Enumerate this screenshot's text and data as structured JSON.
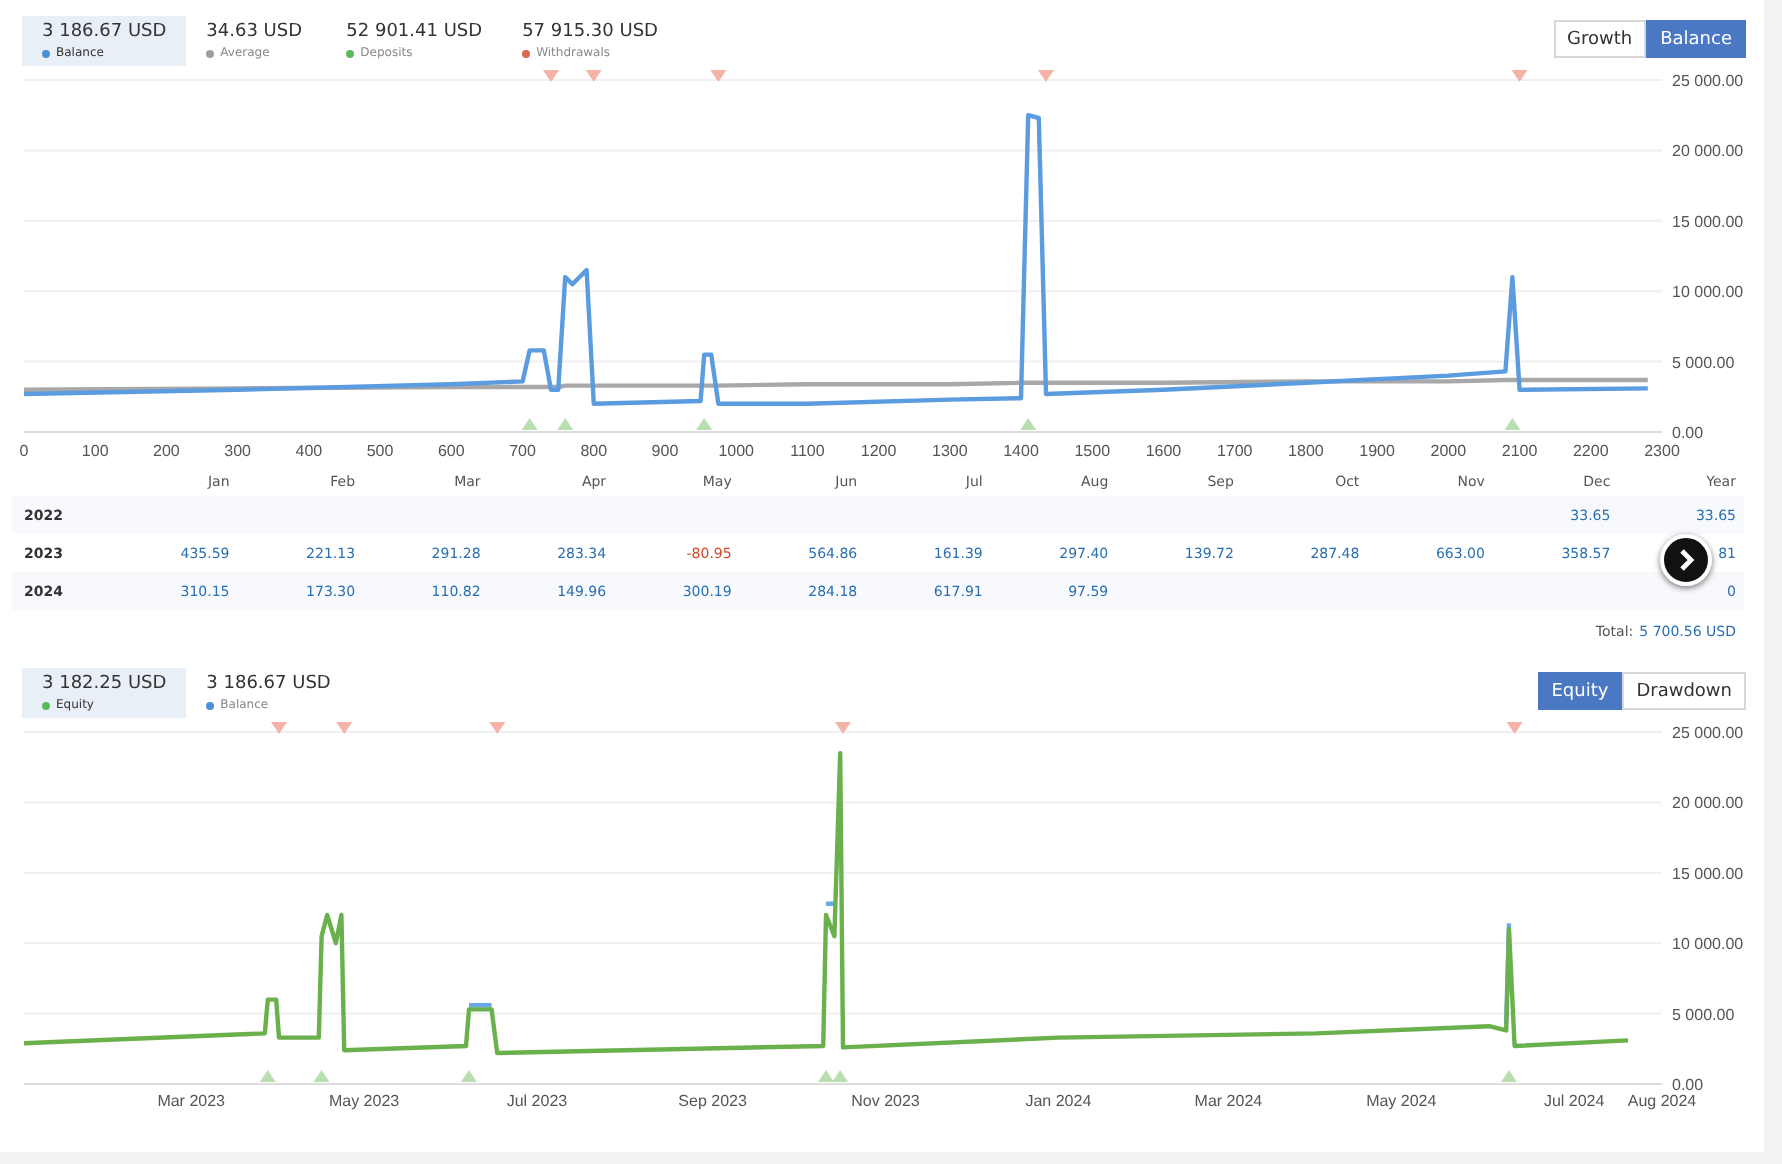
{
  "balance_section": {
    "stats": [
      {
        "value": "3 186.67 USD",
        "label": "Balance",
        "color": "#4a90d9",
        "selected": true
      },
      {
        "value": "34.63 USD",
        "label": "Average",
        "color": "#9e9e9e",
        "selected": false
      },
      {
        "value": "52 901.41 USD",
        "label": "Deposits",
        "color": "#5cb85c",
        "selected": false
      },
      {
        "value": "57 915.30 USD",
        "label": "Withdrawals",
        "color": "#e0664f",
        "selected": false
      }
    ],
    "toggle": [
      {
        "label": "Growth",
        "selected": false
      },
      {
        "label": "Balance",
        "selected": true
      }
    ],
    "chart_data": {
      "type": "line",
      "grid": true,
      "xlim": [
        0,
        2300
      ],
      "ylim": [
        0,
        25000
      ],
      "xticks": [
        0,
        100,
        200,
        300,
        400,
        500,
        600,
        700,
        800,
        900,
        1000,
        1100,
        1200,
        1300,
        1400,
        1500,
        1600,
        1700,
        1800,
        1900,
        2000,
        2100,
        2200,
        2300
      ],
      "yticks": [
        {
          "value": 0,
          "label": "0.00"
        },
        {
          "value": 5000,
          "label": "5 000.00"
        },
        {
          "value": 10000,
          "label": "10 000.00"
        },
        {
          "value": 15000,
          "label": "15 000.00"
        },
        {
          "value": 20000,
          "label": "20 000.00"
        },
        {
          "value": 25000,
          "label": "25 000.00"
        }
      ],
      "x": [
        0,
        300,
        600,
        700,
        710,
        730,
        740,
        750,
        760,
        770,
        790,
        800,
        950,
        955,
        965,
        975,
        1100,
        1300,
        1400,
        1410,
        1425,
        1435,
        1600,
        1800,
        2000,
        2080,
        2090,
        2100,
        2280
      ],
      "series": [
        {
          "color": "#a8a8a8",
          "values": [
            3000,
            3100,
            3200,
            3200,
            3200,
            3200,
            3200,
            3200,
            3300,
            3300,
            3300,
            3300,
            3300,
            3300,
            3300,
            3300,
            3400,
            3400,
            3500,
            3500,
            3500,
            3500,
            3500,
            3600,
            3600,
            3700,
            3700,
            3700,
            3700
          ]
        },
        {
          "color": "#5b9be0",
          "values": [
            2700,
            3000,
            3400,
            3600,
            5800,
            5800,
            3000,
            3000,
            11000,
            10500,
            11500,
            2000,
            2200,
            5500,
            5500,
            2000,
            2000,
            2300,
            2400,
            22500,
            22300,
            2700,
            3000,
            3500,
            4000,
            4300,
            11000,
            3000,
            3100
          ]
        }
      ]
    }
  },
  "monthly_table": {
    "columns": [
      "Jan",
      "Feb",
      "Mar",
      "Apr",
      "May",
      "Jun",
      "Jul",
      "Aug",
      "Sep",
      "Oct",
      "Nov",
      "Dec",
      "Year"
    ],
    "rows": [
      {
        "year": "2022",
        "cells": [
          null,
          null,
          null,
          null,
          null,
          null,
          null,
          null,
          null,
          null,
          null,
          {
            "text": "33.65",
            "loss": false
          },
          {
            "text": "33.65",
            "loss": false
          }
        ]
      },
      {
        "year": "2023",
        "cells": [
          {
            "text": "435.59",
            "loss": false
          },
          {
            "text": "221.13",
            "loss": false
          },
          {
            "text": "291.28",
            "loss": false
          },
          {
            "text": "283.34",
            "loss": false
          },
          {
            "text": "-80.95",
            "loss": true
          },
          {
            "text": "564.86",
            "loss": false
          },
          {
            "text": "161.39",
            "loss": false
          },
          {
            "text": "297.40",
            "loss": false
          },
          {
            "text": "139.72",
            "loss": false
          },
          {
            "text": "287.48",
            "loss": false
          },
          {
            "text": "663.00",
            "loss": false
          },
          {
            "text": "358.57",
            "loss": false
          },
          {
            "text": "81",
            "loss": false
          }
        ]
      },
      {
        "year": "2024",
        "cells": [
          {
            "text": "310.15",
            "loss": false
          },
          {
            "text": "173.30",
            "loss": false
          },
          {
            "text": "110.82",
            "loss": false
          },
          {
            "text": "149.96",
            "loss": false
          },
          {
            "text": "300.19",
            "loss": false
          },
          {
            "text": "284.18",
            "loss": false
          },
          {
            "text": "617.91",
            "loss": false
          },
          {
            "text": "97.59",
            "loss": false
          },
          null,
          null,
          null,
          null,
          {
            "text": "0",
            "loss": false
          }
        ]
      }
    ],
    "total_label": "Total:",
    "total_value": "5 700.56 USD"
  },
  "equity_section": {
    "stats": [
      {
        "value": "3 182.25 USD",
        "label": "Equity",
        "color": "#5cb85c",
        "selected": true
      },
      {
        "value": "3 186.67 USD",
        "label": "Balance",
        "color": "#4a90d9",
        "selected": false
      }
    ],
    "toggle": [
      {
        "label": "Equity",
        "selected": true
      },
      {
        "label": "Drawdown",
        "selected": false
      }
    ],
    "chart_data": {
      "type": "line",
      "grid": true,
      "xlim": [
        "2023-01-01",
        "2024-08-01"
      ],
      "ylim": [
        0,
        25000
      ],
      "xticks": [
        {
          "value": "2023-03-01",
          "label": "Mar 2023"
        },
        {
          "value": "2023-05-01",
          "label": "May 2023"
        },
        {
          "value": "2023-07-01",
          "label": "Jul 2023"
        },
        {
          "value": "2023-09-01",
          "label": "Sep 2023"
        },
        {
          "value": "2023-11-01",
          "label": "Nov 2023"
        },
        {
          "value": "2024-01-01",
          "label": "Jan 2024"
        },
        {
          "value": "2024-03-01",
          "label": "Mar 2024"
        },
        {
          "value": "2024-05-01",
          "label": "May 2024"
        },
        {
          "value": "2024-07-01",
          "label": "Jul 2024"
        },
        {
          "value": "2024-08-01",
          "label": "Aug 2024"
        }
      ],
      "yticks": [
        {
          "value": 0,
          "label": "0.00"
        },
        {
          "value": 5000,
          "label": "5 000.00"
        },
        {
          "value": 10000,
          "label": "10 000.00"
        },
        {
          "value": 15000,
          "label": "15 000.00"
        },
        {
          "value": 20000,
          "label": "20 000.00"
        },
        {
          "value": 25000,
          "label": "25 000.00"
        }
      ],
      "x": [
        "2023-01-01",
        "2023-03-15",
        "2023-03-27",
        "2023-03-28",
        "2023-03-31",
        "2023-04-01",
        "2023-04-15",
        "2023-04-16",
        "2023-04-18",
        "2023-04-21",
        "2023-04-23",
        "2023-04-24",
        "2023-06-06",
        "2023-06-07",
        "2023-06-15",
        "2023-06-17",
        "2023-08-01",
        "2023-10-10",
        "2023-10-11",
        "2023-10-14",
        "2023-10-16",
        "2023-10-17",
        "2024-01-01",
        "2024-04-01",
        "2024-06-01",
        "2024-06-07",
        "2024-06-08",
        "2024-06-10",
        "2024-07-20"
      ],
      "series": [
        {
          "color": "#6aa8e8",
          "values": [
            null,
            null,
            null,
            null,
            null,
            null,
            null,
            null,
            null,
            null,
            null,
            null,
            null,
            5600,
            5600,
            null,
            null,
            null,
            12800,
            12800,
            null,
            null,
            null,
            null,
            null,
            4300,
            11400,
            null,
            null
          ]
        },
        {
          "color": "#6ab04c",
          "values": [
            2900,
            3500,
            3600,
            6000,
            6000,
            3300,
            3300,
            10500,
            12000,
            10000,
            12000,
            2400,
            2700,
            5300,
            5300,
            2200,
            2400,
            2700,
            12000,
            10500,
            23500,
            2600,
            3300,
            3600,
            4100,
            3800,
            11000,
            2700,
            3100
          ]
        }
      ]
    }
  }
}
